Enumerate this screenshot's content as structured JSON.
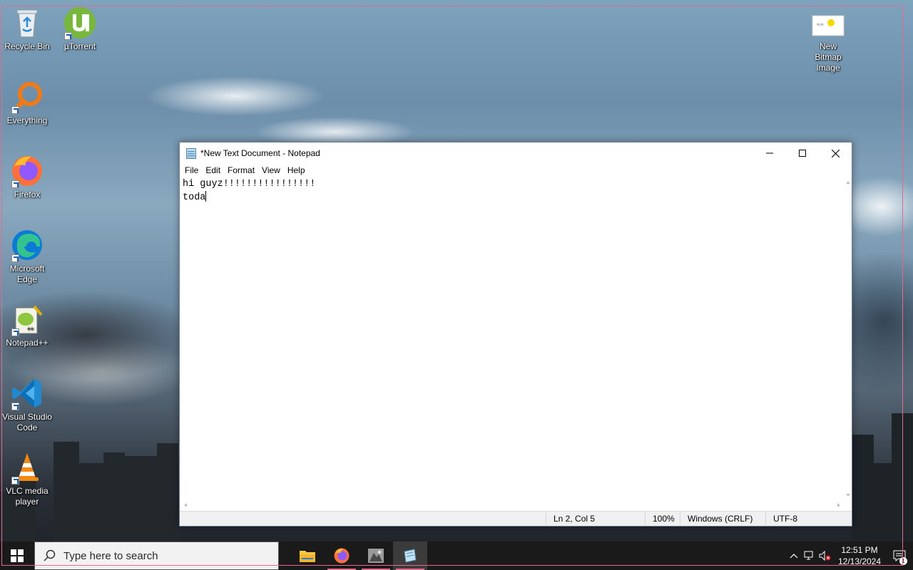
{
  "desktop": {
    "icons": [
      {
        "label": "Recycle Bin"
      },
      {
        "label": "µTorrent"
      },
      {
        "label": "Everything"
      },
      {
        "label": "Firefox"
      },
      {
        "label": "Microsoft Edge"
      },
      {
        "label": "Notepad++"
      },
      {
        "label": "Visual Studio Code"
      },
      {
        "label": "VLC media player"
      },
      {
        "label": "New Bitmap Image"
      }
    ]
  },
  "notepad": {
    "title": "*New Text Document - Notepad",
    "menu": [
      "File",
      "Edit",
      "Format",
      "View",
      "Help"
    ],
    "content": {
      "line1": "hi guyz!!!!!!!!!!!!!!!!",
      "line2": "toda"
    },
    "status": {
      "position": "Ln 2, Col 5",
      "zoom": "100%",
      "line_ending": "Windows (CRLF)",
      "encoding": "UTF-8"
    }
  },
  "taskbar": {
    "search_placeholder": "Type here to search",
    "time": "12:51 PM",
    "date": "12/13/2024",
    "notification_count": "1"
  },
  "colors": {
    "frame_accent": "#e36a8c",
    "taskbar_bg": "#1a1a1a"
  }
}
